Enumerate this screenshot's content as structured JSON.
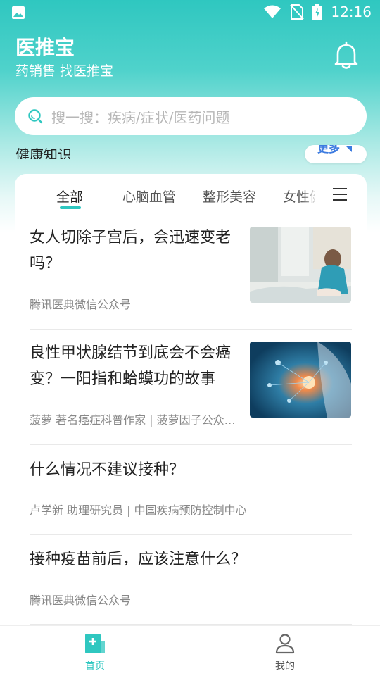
{
  "status_bar": {
    "time": "12:16"
  },
  "header": {
    "title": "医推宝",
    "subtitle": "药销售 找医推宝"
  },
  "search": {
    "placeholder": "搜一搜：疾病/症状/医药问题"
  },
  "section": {
    "title": "健康知识",
    "more_label": "更多"
  },
  "tabs": [
    {
      "label": "全部",
      "active": true
    },
    {
      "label": "心脑血管",
      "active": false
    },
    {
      "label": "整形美容",
      "active": false
    },
    {
      "label": "女性健康",
      "active": false
    }
  ],
  "articles": [
    {
      "title_line1": "女人切除子宫后，会迅速变老",
      "title_line2": "吗？",
      "source": "腾讯医典微信公众号",
      "has_image": true
    },
    {
      "title_line1": "良性甲状腺结节到底会不会癌",
      "title_line2": "变？一阳指和蛤蟆功的故事",
      "source": "菠萝 著名癌症科普作家 | 菠萝因子公众…",
      "has_image": true
    },
    {
      "title_line1": "什么情况不建议接种？",
      "title_line2": "",
      "source": "卢学新 助理研究员 | 中国疾病预防控制中心",
      "has_image": false
    },
    {
      "title_line1": "接种疫苗前后，应该注意什么？",
      "title_line2": "",
      "source": "腾讯医典微信公众号",
      "has_image": false
    }
  ],
  "bottom_nav": [
    {
      "label": "首页",
      "icon": "home-doc-icon",
      "active": true
    },
    {
      "label": "我的",
      "icon": "profile-icon",
      "active": false
    }
  ],
  "colors": {
    "accent": "#2fc7c0",
    "link": "#3c7be0"
  }
}
